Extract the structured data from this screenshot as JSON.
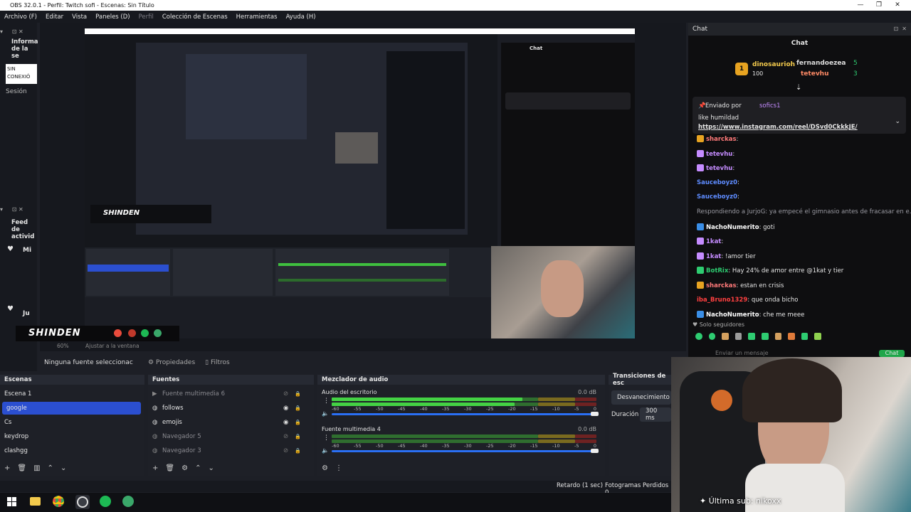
{
  "window": {
    "title": "OBS 32.0.1 - Perfil: Twitch sofi - Escenas: Sin Título"
  },
  "menu": [
    {
      "label": "Archivo (F)",
      "enabled": true
    },
    {
      "label": "Editar",
      "enabled": true
    },
    {
      "label": "Vista",
      "enabled": true
    },
    {
      "label": "Paneles (D)",
      "enabled": true
    },
    {
      "label": "Perfil",
      "enabled": false
    },
    {
      "label": "Colección de Escenas",
      "enabled": true
    },
    {
      "label": "Herramientas",
      "enabled": true
    },
    {
      "label": "Ayuda (H)",
      "enabled": true
    }
  ],
  "left_docks": {
    "info_title": "Informa de la se",
    "status": "SIN CONEXIÓ",
    "session_label": "Sesión",
    "feed_title": "Feed de activid",
    "feed_items": [
      "Mi",
      "Ju"
    ]
  },
  "preview_toolbar": {
    "zoom": "60%",
    "fit_label": "Ajustar a la ventana"
  },
  "source_bar": {
    "no_source": "Ninguna fuente seleccionac",
    "properties": "Propiedades",
    "filters": "Filtros"
  },
  "scenes": {
    "title": "Escenas",
    "items": [
      {
        "label": "Escena 1",
        "selected": false
      },
      {
        "label": "google",
        "selected": true
      },
      {
        "label": "Cs",
        "selected": false
      },
      {
        "label": "keydrop",
        "selected": false
      },
      {
        "label": "clashgg",
        "selected": false
      }
    ]
  },
  "sources": {
    "title": "Fuentes",
    "items": [
      {
        "label": "Fuente multimedia 6",
        "icon": "play-icon",
        "visible": false
      },
      {
        "label": "follows",
        "icon": "globe-icon",
        "visible": true
      },
      {
        "label": "emojis",
        "icon": "globe-icon",
        "visible": true
      },
      {
        "label": "Navegador 5",
        "icon": "globe-icon",
        "visible": false
      },
      {
        "label": "Navegador 3",
        "icon": "globe-icon",
        "visible": false
      }
    ]
  },
  "mixer": {
    "title": "Mezclador de audio",
    "channels": [
      {
        "name": "Audio del escritorio",
        "db": "0.0 dB",
        "level": 0.72
      },
      {
        "name": "Fuente multimedia 4",
        "db": "0.0 dB",
        "level": 0.0
      }
    ],
    "ticks": [
      "-60",
      "-55",
      "-50",
      "-45",
      "-40",
      "-35",
      "-30",
      "-25",
      "-20",
      "-15",
      "-10",
      "-5",
      "0"
    ]
  },
  "transitions": {
    "title": "Transiciones de esc",
    "type": "Desvanecimiento",
    "duration_label": "Duración",
    "duration_value": "300 ms"
  },
  "statusbar": {
    "delay": "Retardo (1 sec)",
    "dropped": "Fotogramas Perdidos 0"
  },
  "chat": {
    "dock_title": "Chat",
    "panel_title": "Chat",
    "leaderboard": [
      {
        "name": "dinosaurioh",
        "amount": "100",
        "rank": "1"
      },
      {
        "name": "fernandoezea",
        "amount": "5"
      },
      {
        "name": "tetevhu",
        "amount": "3"
      }
    ],
    "pinned": {
      "label": "Enviado por",
      "user": "sofics1",
      "text": "like humildad",
      "link": "https://www.instagram.com/reel/DSvd0CkkkJE/"
    },
    "messages": [
      {
        "user": "sharckas",
        "color": "#ff7a7a",
        "text": ":"
      },
      {
        "user": "tetevhu",
        "color": "#c58cff",
        "text": ":"
      },
      {
        "user": "tetevhu",
        "color": "#c58cff",
        "text": ":"
      },
      {
        "user": "Sauceboyz0",
        "color": "#5e8cff",
        "text": ":"
      },
      {
        "user": "Sauceboyz0",
        "color": "#5e8cff",
        "text": ":"
      },
      {
        "user": "",
        "color": "#9a9aa2",
        "text": "Respondiendo a JurjoG: ya empecé el gimnasio antes de fracasar en e..."
      },
      {
        "user": "NachoNumerito",
        "color": "#ffffff",
        "text": ": goti"
      },
      {
        "user": "1kat",
        "color": "#c58cff",
        "text": ":"
      },
      {
        "user": "1kat",
        "color": "#c58cff",
        "text": ": !amor tier"
      },
      {
        "user": "BotRix",
        "color": "#2ecc71",
        "text": ": Hay 24% de amor entre @1kat y tier"
      },
      {
        "user": "sharckas",
        "color": "#ff7a7a",
        "text": ": estan en crisis"
      },
      {
        "user": "iba_Bruno1329",
        "color": "#ff4040",
        "text": ": que onda bicho"
      },
      {
        "user": "NachoNumerito",
        "color": "#ffffff",
        "text": ": che me meee"
      }
    ],
    "followers_only": "Solo seguidores",
    "input_placeholder": "Enviar un mensaje",
    "send_label": "Chat"
  },
  "webcam": {
    "caption": "Última sub: nikoxx"
  },
  "logo_text": "SHINDEN"
}
